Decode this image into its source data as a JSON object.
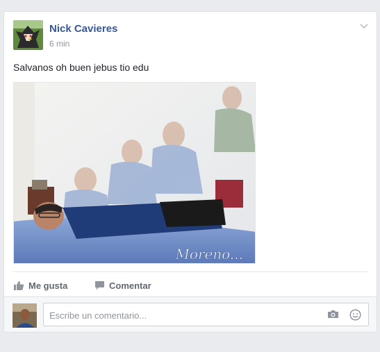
{
  "post": {
    "author": "Nick Cavieres",
    "time": "6 min",
    "text": "Salvanos oh buen jebus tio edu",
    "image": {
      "watermark": "Moreno..."
    }
  },
  "actions": {
    "like_label": "Me gusta",
    "comment_label": "Comentar"
  },
  "comment": {
    "placeholder": "Escribe un comentario..."
  },
  "icons": {
    "menu": "chevron-down-icon",
    "like": "thumbs-up-icon",
    "comment": "speech-bubble-icon",
    "camera": "camera-icon",
    "emoji": "smiley-icon"
  },
  "colors": {
    "author": "#365899",
    "action": "#616770",
    "page_bg": "#e9ebee"
  }
}
